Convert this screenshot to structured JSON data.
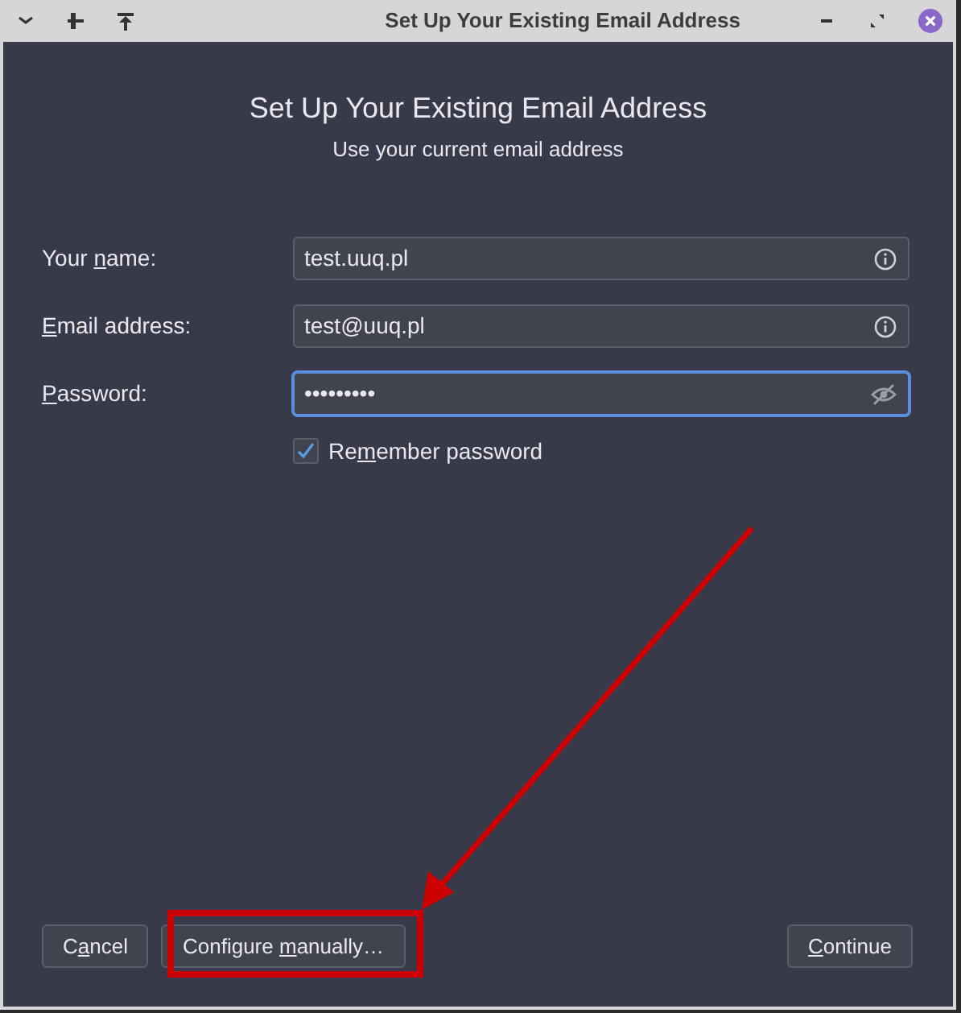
{
  "window": {
    "title": "Set Up Your Existing Email Address"
  },
  "heading": "Set Up Your Existing Email Address",
  "subheading": "Use your current email address",
  "fields": [
    {
      "kind": "text",
      "label": {
        "before": "Your ",
        "key": "n",
        "after": "ame:"
      },
      "value": "test.uuq.pl",
      "focused": false
    },
    {
      "kind": "text",
      "label": {
        "key": "E",
        "after": "mail address:"
      },
      "value": "test@uuq.pl",
      "focused": false
    },
    {
      "kind": "password",
      "label": {
        "key": "P",
        "after": "assword:"
      },
      "value": "•••••••••",
      "focused": true
    }
  ],
  "remember": {
    "label": {
      "before": "Re",
      "key": "m",
      "after": "ember password"
    },
    "checked": true
  },
  "buttons": [
    {
      "label": {
        "before": "C",
        "key": "a",
        "after": "ncel"
      },
      "kind": "start"
    },
    {
      "label": {
        "before": "Configure ",
        "key": "m",
        "after": "anually…"
      },
      "kind": "start"
    },
    {
      "label": {
        "key": "C",
        "after": "ontinue"
      },
      "kind": "end"
    }
  ],
  "annotations": {
    "arrow": true,
    "highlight_box": true
  }
}
